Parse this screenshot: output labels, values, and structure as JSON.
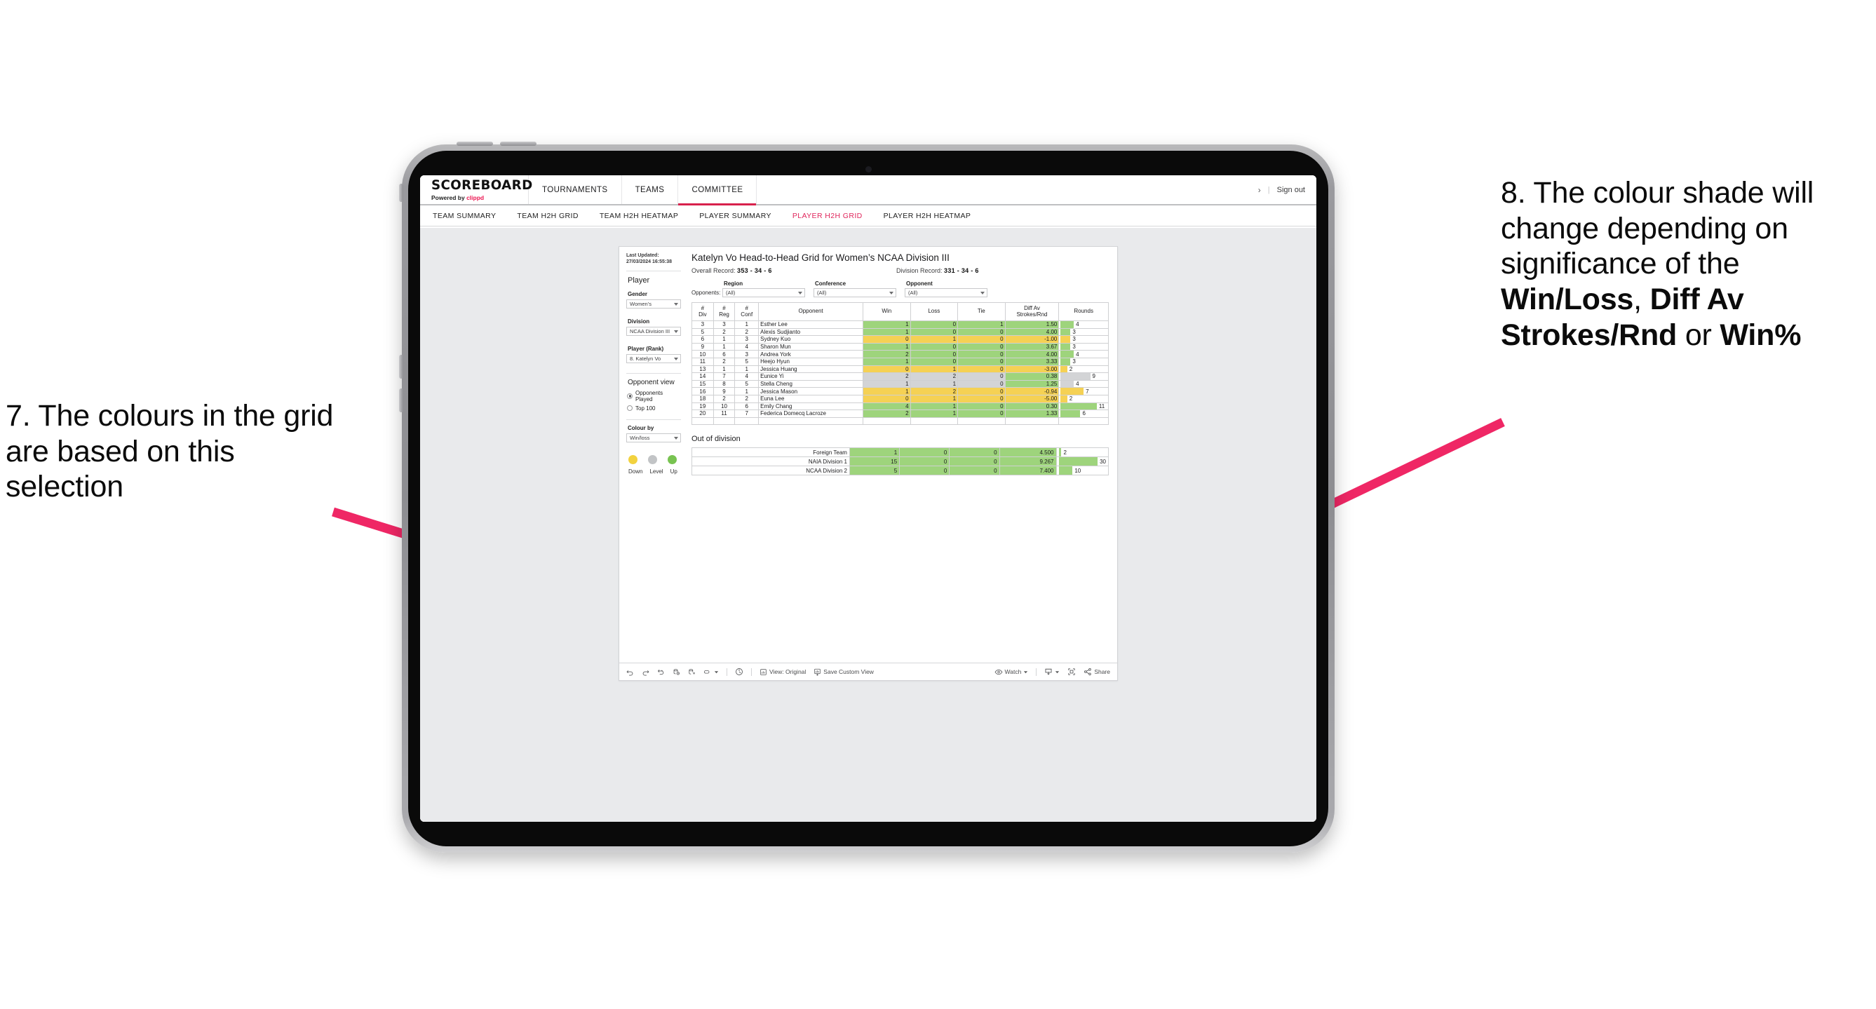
{
  "annotations": {
    "left": {
      "id": "annotation-7",
      "text": "7. The colours in the grid are based on this selection"
    },
    "right": {
      "id": "annotation-8",
      "line1": "8. The colour shade will change depending on significance of the ",
      "bold1": "Win/Loss",
      "mid1": ", ",
      "bold2": "Diff Av Strokes/Rnd",
      "mid2": " or ",
      "bold3": "Win%"
    },
    "arrow_color": "#ef2765"
  },
  "topbar": {
    "brand_name": "SCOREBOARD",
    "brand_sub_prefix": "Powered by ",
    "brand_sub_highlight": "clippd",
    "nav": [
      {
        "label": "TOURNAMENTS",
        "active": false
      },
      {
        "label": "TEAMS",
        "active": false
      },
      {
        "label": "COMMITTEE",
        "active": true
      }
    ],
    "chevron": "›",
    "separator": "|",
    "sign_out": "Sign out",
    "accent": "#d8214c"
  },
  "subnav": {
    "items": [
      {
        "label": "TEAM SUMMARY",
        "active": false
      },
      {
        "label": "TEAM H2H GRID",
        "active": false
      },
      {
        "label": "TEAM H2H HEATMAP",
        "active": false
      },
      {
        "label": "PLAYER SUMMARY",
        "active": false
      },
      {
        "label": "PLAYER H2H GRID",
        "active": true
      },
      {
        "label": "PLAYER H2H HEATMAP",
        "active": false
      }
    ],
    "active_color": "#e0265c"
  },
  "sidebar": {
    "last_updated": "Last Updated: 27/03/2024 16:55:38",
    "player_section_title": "Player",
    "gender_label": "Gender",
    "gender_value": "Women’s",
    "division_label": "Division",
    "division_value": "NCAA Division III",
    "player_rank_label": "Player (Rank)",
    "player_rank_value": "8. Katelyn Vo",
    "opponent_view_title": "Opponent view",
    "opponent_view_options": [
      {
        "label": "Opponents Played",
        "selected": true
      },
      {
        "label": "Top 100",
        "selected": false
      }
    ],
    "colour_by_label": "Colour by",
    "colour_by_value": "Win/loss",
    "legend": [
      {
        "label": "Down",
        "color": "#f2d23f"
      },
      {
        "label": "Level",
        "color": "#c2c4c6"
      },
      {
        "label": "Up",
        "color": "#78c351"
      }
    ]
  },
  "main": {
    "title": "Katelyn Vo Head-to-Head Grid for Women’s NCAA Division III",
    "overall_record_label": "Overall Record: ",
    "overall_record_value": "353 - 34 - 6",
    "division_record_label": "Division Record: ",
    "division_record_value": "331 - 34 - 6",
    "opponents_label": "Opponents:",
    "filters": [
      {
        "label": "Region",
        "value": "(All)"
      },
      {
        "label": "Conference",
        "value": "(All)"
      },
      {
        "label": "Opponent",
        "value": "(All)"
      }
    ],
    "out_of_division_title": "Out of division"
  },
  "chart_data": {
    "type": "table",
    "title": "Katelyn Vo Head-to-Head Grid for Women’s NCAA Division III",
    "columns": [
      "# Div",
      "# Reg",
      "# Conf",
      "Opponent",
      "Win",
      "Loss",
      "Tie",
      "Diff Av Strokes/Rnd",
      "Rounds"
    ],
    "colour_by": "Win/loss",
    "colour_scale": {
      "up": "#9ed47c",
      "level": "#d3d4d6",
      "down": "#f5d154"
    },
    "rounds_axis_max": 14,
    "rows": [
      {
        "div": "3",
        "reg": "3",
        "conf": "1",
        "opponent": "Esther Lee",
        "win": "1",
        "loss": "0",
        "tie": "1",
        "diff": "1.50",
        "rounds": 4,
        "state": "g"
      },
      {
        "div": "5",
        "reg": "2",
        "conf": "2",
        "opponent": "Alexis Sudjianto",
        "win": "1",
        "loss": "0",
        "tie": "0",
        "diff": "4.00",
        "rounds": 3,
        "state": "g"
      },
      {
        "div": "6",
        "reg": "1",
        "conf": "3",
        "opponent": "Sydney Kuo",
        "win": "0",
        "loss": "1",
        "tie": "0",
        "diff": "-1.00",
        "rounds": 3,
        "state": "y"
      },
      {
        "div": "9",
        "reg": "1",
        "conf": "4",
        "opponent": "Sharon Mun",
        "win": "1",
        "loss": "0",
        "tie": "0",
        "diff": "3.67",
        "rounds": 3,
        "state": "g"
      },
      {
        "div": "10",
        "reg": "6",
        "conf": "3",
        "opponent": "Andrea York",
        "win": "2",
        "loss": "0",
        "tie": "0",
        "diff": "4.00",
        "rounds": 4,
        "state": "g"
      },
      {
        "div": "11",
        "reg": "2",
        "conf": "5",
        "opponent": "Heejo Hyun",
        "win": "1",
        "loss": "0",
        "tie": "0",
        "diff": "3.33",
        "rounds": 3,
        "state": "g"
      },
      {
        "div": "13",
        "reg": "1",
        "conf": "1",
        "opponent": "Jessica Huang",
        "win": "0",
        "loss": "1",
        "tie": "0",
        "diff": "-3.00",
        "rounds": 2,
        "state": "y"
      },
      {
        "div": "14",
        "reg": "7",
        "conf": "4",
        "opponent": "Eunice Yi",
        "win": "2",
        "loss": "2",
        "tie": "0",
        "diff": "0.38",
        "rounds": 9,
        "state": "n",
        "diff_state": "g"
      },
      {
        "div": "15",
        "reg": "8",
        "conf": "5",
        "opponent": "Stella Cheng",
        "win": "1",
        "loss": "1",
        "tie": "0",
        "diff": "1.25",
        "rounds": 4,
        "state": "n",
        "diff_state": "g"
      },
      {
        "div": "16",
        "reg": "9",
        "conf": "1",
        "opponent": "Jessica Mason",
        "win": "1",
        "loss": "2",
        "tie": "0",
        "diff": "-0.94",
        "rounds": 7,
        "state": "y"
      },
      {
        "div": "18",
        "reg": "2",
        "conf": "2",
        "opponent": "Euna Lee",
        "win": "0",
        "loss": "1",
        "tie": "0",
        "diff": "-5.00",
        "rounds": 2,
        "state": "y"
      },
      {
        "div": "19",
        "reg": "10",
        "conf": "6",
        "opponent": "Emily Chang",
        "win": "4",
        "loss": "1",
        "tie": "0",
        "diff": "0.30",
        "rounds": 11,
        "state": "g"
      },
      {
        "div": "20",
        "reg": "11",
        "conf": "7",
        "opponent": "Federica Domecq Lacroze",
        "win": "2",
        "loss": "1",
        "tie": "0",
        "diff": "1.33",
        "rounds": 6,
        "state": "g"
      }
    ],
    "out_of_division": {
      "rounds_axis_max": 34,
      "rows": [
        {
          "name": "Foreign Team",
          "win": "1",
          "loss": "0",
          "tie": "0",
          "diff": "4.500",
          "rounds": 2,
          "state": "g"
        },
        {
          "name": "NAIA Division 1",
          "win": "15",
          "loss": "0",
          "tie": "0",
          "diff": "9.267",
          "rounds": 30,
          "state": "g"
        },
        {
          "name": "NCAA Division 2",
          "win": "5",
          "loss": "0",
          "tie": "0",
          "diff": "7.400",
          "rounds": 10,
          "state": "g"
        }
      ]
    }
  },
  "toolbar": {
    "view_label": "View: Original",
    "save_label": "Save Custom View",
    "watch_label": "Watch",
    "share_label": "Share"
  }
}
